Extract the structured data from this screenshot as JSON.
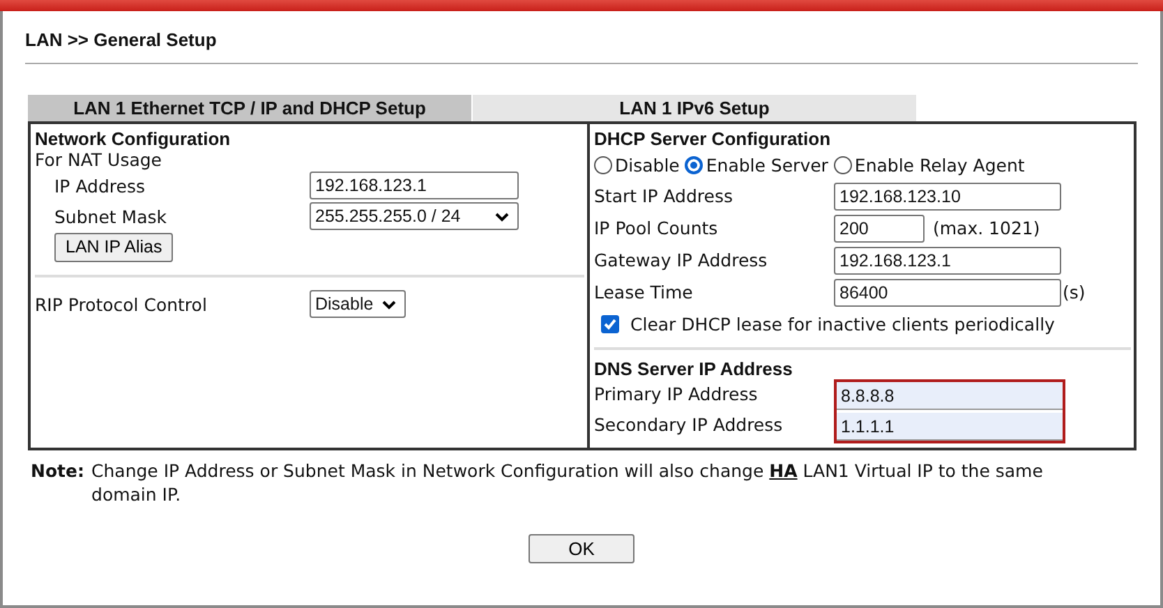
{
  "breadcrumb": "LAN >> General Setup",
  "tabs": [
    {
      "label": "LAN 1 Ethernet TCP / IP and DHCP Setup",
      "selected": true
    },
    {
      "label": "LAN 1 IPv6 Setup",
      "selected": false
    }
  ],
  "network_configuration": {
    "title": "Network Configuration",
    "subtitle": "For NAT Usage",
    "fields": [
      {
        "label": "IP Address",
        "kind": "text",
        "value": "192.168.123.1"
      },
      {
        "label": "Subnet Mask",
        "kind": "select",
        "value": "255.255.255.0 / 24"
      }
    ],
    "alias_button": "LAN IP Alias",
    "rip": {
      "label": "RIP Protocol Control",
      "value": "Disable"
    }
  },
  "dhcp": {
    "title": "DHCP Server Configuration",
    "modes": [
      {
        "label": "Disable",
        "selected": false
      },
      {
        "label": "Enable Server",
        "selected": true
      },
      {
        "label": "Enable Relay Agent",
        "selected": false
      }
    ],
    "fields": [
      {
        "label": "Start IP Address",
        "kind": "wide",
        "value": "192.168.123.10"
      },
      {
        "label": "IP Pool Counts",
        "kind": "short",
        "value": "200",
        "suffix": "(max. 1021)"
      },
      {
        "label": "Gateway IP Address",
        "kind": "wide",
        "value": "192.168.123.1"
      },
      {
        "label": "Lease Time",
        "kind": "wide",
        "value": "86400",
        "suffix": "(s)"
      }
    ],
    "clear_lease": {
      "label": "Clear DHCP lease for inactive clients periodically",
      "checked": true
    }
  },
  "dns": {
    "title": "DNS Server IP Address",
    "fields": [
      {
        "label": "Primary IP Address",
        "value": "8.8.8.8"
      },
      {
        "label": "Secondary IP Address",
        "value": "1.1.1.1"
      }
    ]
  },
  "note": {
    "label": "Note:",
    "before": "Change IP Address or Subnet Mask in Network Configuration will also change",
    "link": "HA",
    "after": "LAN1 Virtual IP to the same domain IP."
  },
  "ok_button": "OK"
}
